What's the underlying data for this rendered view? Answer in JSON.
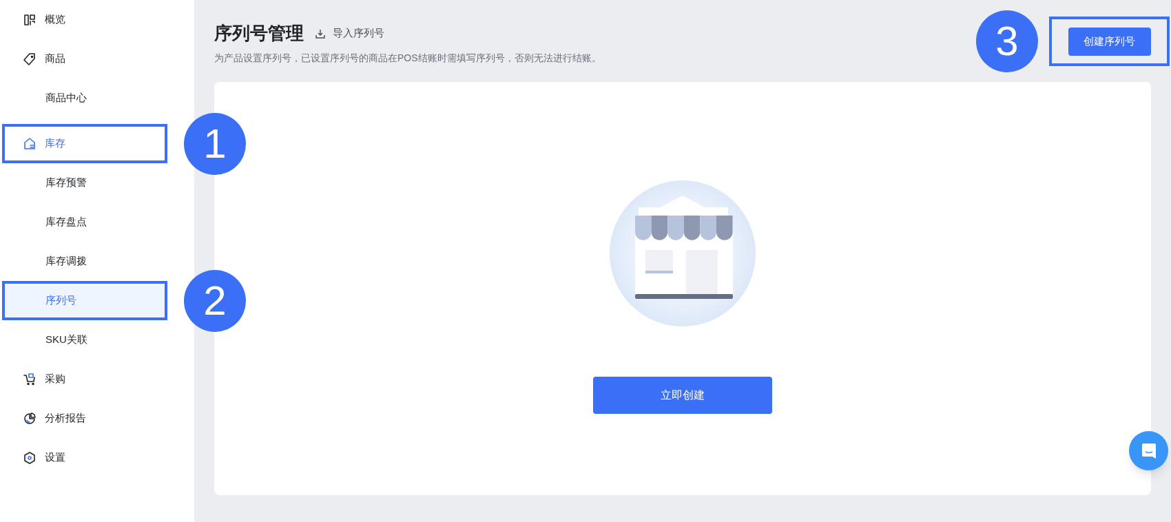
{
  "sidebar": {
    "items": [
      {
        "label": "概览",
        "active": false,
        "selected": false
      },
      {
        "label": "商品",
        "active": false,
        "selected": false,
        "children": [
          {
            "label": "商品中心",
            "selected": false
          }
        ]
      },
      {
        "label": "库存",
        "active": true,
        "selected": false,
        "callout": "1",
        "children": [
          {
            "label": "库存预警",
            "selected": false
          },
          {
            "label": "库存盘点",
            "selected": false
          },
          {
            "label": "库存调拨",
            "selected": false
          },
          {
            "label": "序列号",
            "selected": true,
            "callout": "2"
          },
          {
            "label": "SKU关联",
            "selected": false
          }
        ]
      },
      {
        "label": "采购",
        "active": false,
        "selected": false
      },
      {
        "label": "分析报告",
        "active": false,
        "selected": false
      },
      {
        "label": "设置",
        "active": false,
        "selected": false
      }
    ]
  },
  "header": {
    "title": "序列号管理",
    "import_link": "导入序列号",
    "description": "为产品设置序列号，已设置序列号的商品在POS结账时需填写序列号，否则无法进行结账。",
    "create_button": {
      "label": "创建序列号",
      "callout": "3"
    }
  },
  "empty_state": {
    "button": "立即创建"
  }
}
